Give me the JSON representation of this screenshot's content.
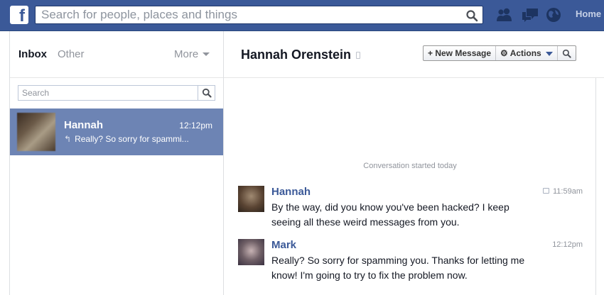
{
  "topbar": {
    "logo_letter": "f",
    "search_placeholder": "Search for people, places and things",
    "home_label": "Home",
    "icons": [
      "search-icon",
      "friend-requests-icon",
      "messages-icon",
      "notifications-globe-icon"
    ]
  },
  "sidebar": {
    "tab_inbox": "Inbox",
    "tab_other": "Other",
    "more_label": "More",
    "search_placeholder": "Search",
    "threads": [
      {
        "name": "Hannah",
        "time": "12:12pm",
        "snippet": "Really? So sorry for spammi..."
      }
    ]
  },
  "conversation": {
    "title": "Hannah Orenstein",
    "new_message_label": "New Message",
    "actions_label": "Actions",
    "started_label": "Conversation started today",
    "messages": [
      {
        "sender": "Hannah",
        "time": "11:59am",
        "lines": [
          "By the way, did you know you've been hacked? I keep",
          "seeing all these weird messages from you."
        ]
      },
      {
        "sender": "Mark",
        "time": "12:12pm",
        "lines": [
          "Really? So sorry for spamming you. Thanks for letting me",
          "know! I'm going to try to fix the problem now."
        ]
      }
    ]
  },
  "colors": {
    "topbar": "#3b5998",
    "selected_thread": "#6d84b4",
    "name_link": "#3b5998"
  }
}
